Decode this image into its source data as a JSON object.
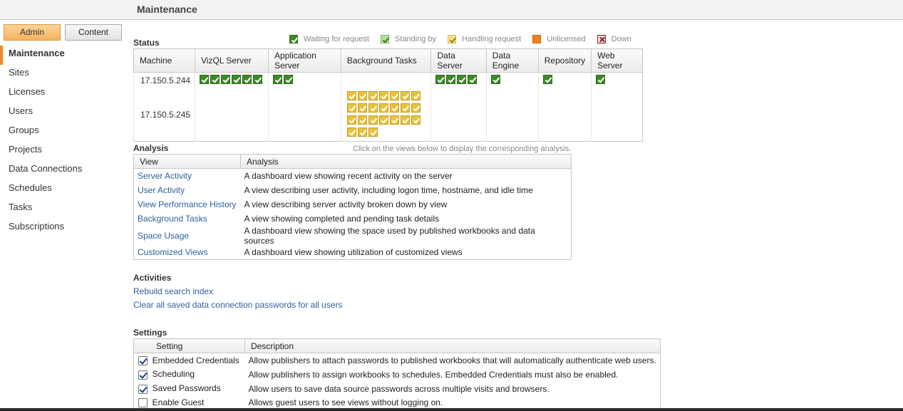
{
  "header": {
    "title": "Maintenance"
  },
  "tabs": {
    "admin": "Admin",
    "content": "Content"
  },
  "sidebar": {
    "items": [
      {
        "label": "Maintenance",
        "active": true
      },
      {
        "label": "Sites"
      },
      {
        "label": "Licenses"
      },
      {
        "label": "Users"
      },
      {
        "label": "Groups"
      },
      {
        "label": "Projects"
      },
      {
        "label": "Data Connections"
      },
      {
        "label": "Schedules"
      },
      {
        "label": "Tasks"
      },
      {
        "label": "Subscriptions"
      }
    ]
  },
  "status": {
    "heading": "Status",
    "legend": [
      {
        "label": "Waiting for request",
        "icon": "check-green-icon"
      },
      {
        "label": "Standing by",
        "icon": "check-light-green-icon"
      },
      {
        "label": "Handling request",
        "icon": "check-yellow-icon"
      },
      {
        "label": "Unlicensed",
        "icon": "orange-square-icon"
      },
      {
        "label": "Down",
        "icon": "red-x-icon"
      }
    ],
    "columns": [
      "Machine",
      "VizQL Server",
      "Application Server",
      "Background Tasks",
      "Data Server",
      "Data Engine",
      "Repository",
      "Web Server"
    ],
    "rows": [
      {
        "machine": "17.150.5.244",
        "vizql": 6,
        "app": 2,
        "bg": 0,
        "data_server": 4,
        "data_engine": 1,
        "repository": 1,
        "web": 1
      },
      {
        "machine": "17.150.5.245",
        "vizql": 0,
        "app": 0,
        "bg": 24,
        "data_server": 0,
        "data_engine": 0,
        "repository": 0,
        "web": 0
      }
    ]
  },
  "analysis": {
    "heading": "Analysis",
    "hint": "Click on the views below to display the corresponding analysis.",
    "columns": [
      "View",
      "Analysis"
    ],
    "rows": [
      {
        "view": "Server Activity",
        "desc": "A dashboard view showing recent activity on the server"
      },
      {
        "view": "User Activity",
        "desc": "A view describing user activity, including logon time, hostname, and idle time"
      },
      {
        "view": "View Performance History",
        "desc": "A view describing server activity broken down by view"
      },
      {
        "view": "Background Tasks",
        "desc": "A view showing completed and pending task details"
      },
      {
        "view": "Space Usage",
        "desc": "A dashboard view showing the space used by published workbooks and data sources"
      },
      {
        "view": "Customized Views",
        "desc": "A dashboard view showing utilization of customized views"
      }
    ]
  },
  "activities": {
    "heading": "Activities",
    "links": [
      "Rebuild search index",
      "Clear all saved data connection passwords for all users"
    ]
  },
  "settings": {
    "heading": "Settings",
    "columns": [
      "Setting",
      "Description"
    ],
    "rows": [
      {
        "checked": true,
        "name": "Embedded Credentials",
        "desc": "Allow publishers to attach passwords to published workbooks that will automatically authenticate web users."
      },
      {
        "checked": true,
        "name": "Scheduling",
        "desc": "Allow publishers to assign workbooks to schedules. Embedded Credentials must also be enabled."
      },
      {
        "checked": true,
        "name": "Saved Passwords",
        "desc": "Allow users to save data source passwords across multiple visits and browsers."
      },
      {
        "checked": false,
        "name": "Enable Guest",
        "desc": "Allows guest users to see views without logging on."
      }
    ]
  }
}
